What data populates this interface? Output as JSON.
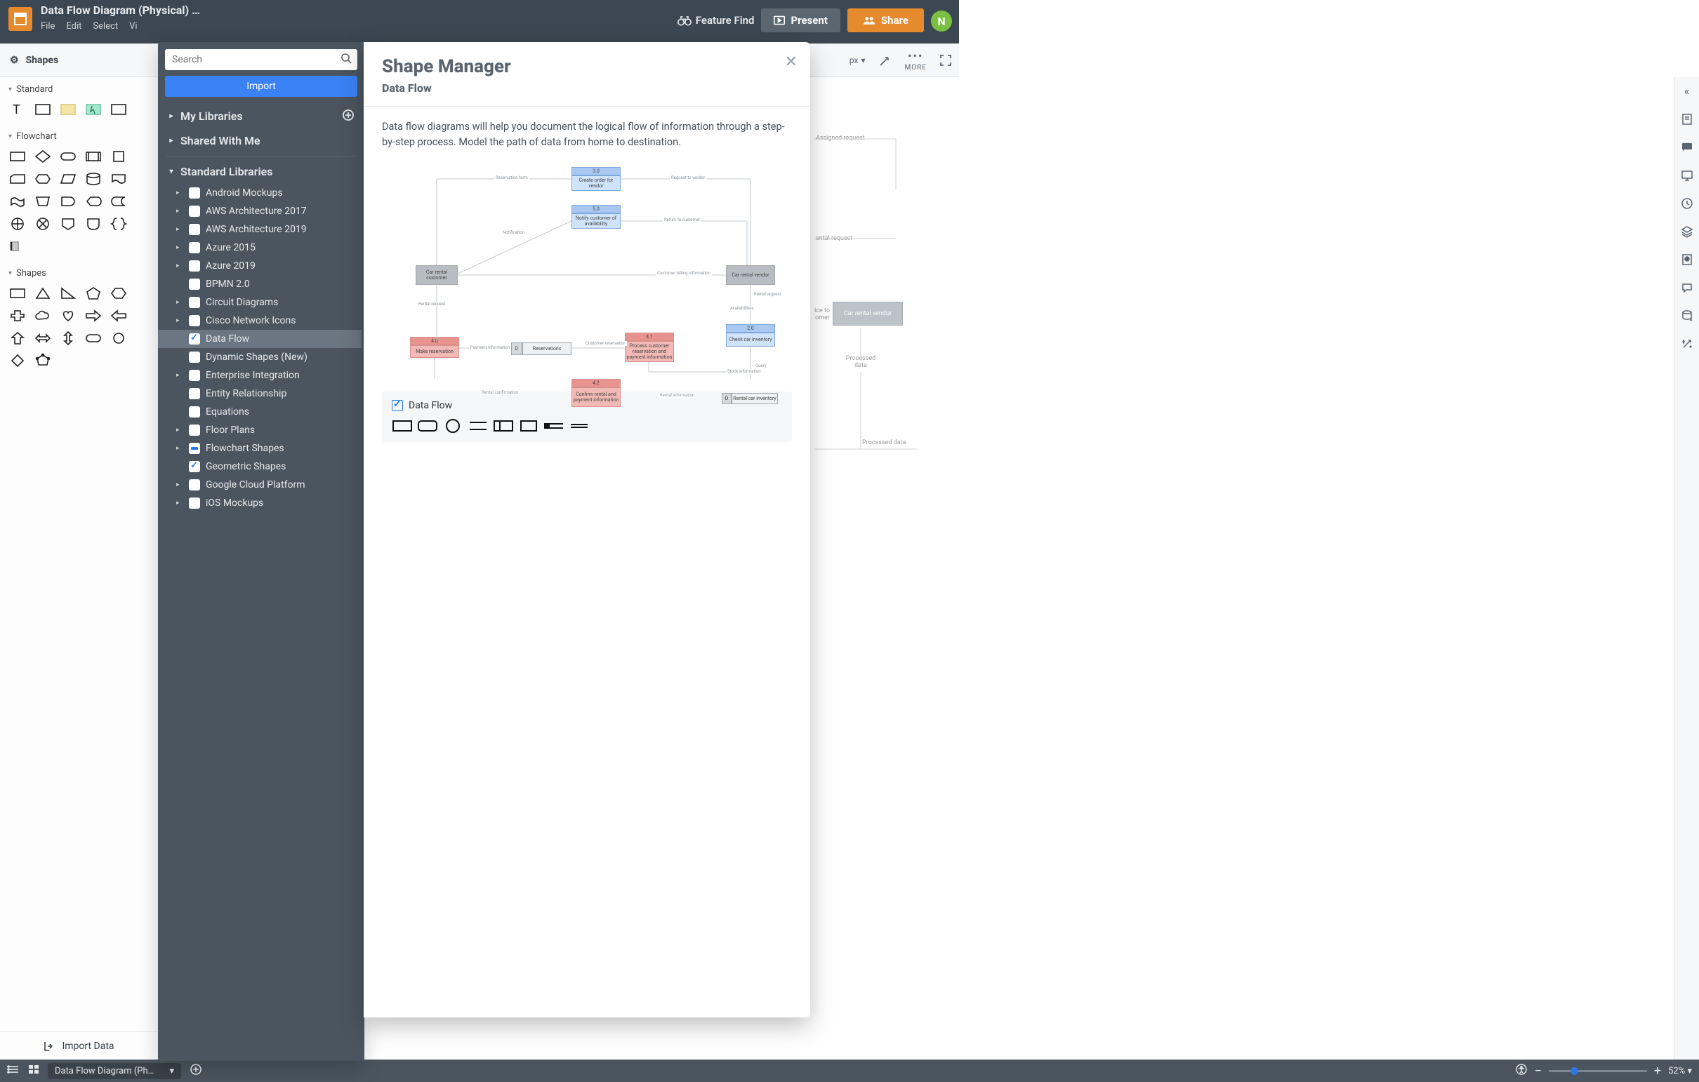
{
  "header": {
    "doc_title": "Data Flow Diagram (Physical) …",
    "menu": [
      "File",
      "Edit",
      "Select",
      "Vi"
    ],
    "feature_find": "Feature Find",
    "present": "Present",
    "share": "Share",
    "avatar_initial": "N"
  },
  "toolbar": {
    "zoom_unit_hint": "px",
    "more": "MORE"
  },
  "shapes_panel": {
    "title": "Shapes",
    "groups": {
      "standard": {
        "title": "Standard"
      },
      "flowchart": {
        "title": "Flowchart"
      },
      "shapes": {
        "title": "Shapes"
      }
    },
    "import_data": "Import Data"
  },
  "library_panel": {
    "search_placeholder": "Search",
    "import": "Import",
    "sections": {
      "my_libraries": "My Libraries",
      "shared": "Shared With Me",
      "standard": "Standard Libraries"
    },
    "items": [
      {
        "label": "Android Mockups",
        "expandable": true,
        "checked": false
      },
      {
        "label": "AWS Architecture 2017",
        "expandable": true,
        "checked": false
      },
      {
        "label": "AWS Architecture 2019",
        "expandable": true,
        "checked": false
      },
      {
        "label": "Azure 2015",
        "expandable": true,
        "checked": false
      },
      {
        "label": "Azure 2019",
        "expandable": true,
        "checked": false
      },
      {
        "label": "BPMN 2.0",
        "expandable": false,
        "checked": false
      },
      {
        "label": "Circuit Diagrams",
        "expandable": true,
        "checked": false
      },
      {
        "label": "Cisco Network Icons",
        "expandable": true,
        "checked": false
      },
      {
        "label": "Data Flow",
        "expandable": false,
        "checked": true,
        "selected": true
      },
      {
        "label": "Dynamic Shapes (New)",
        "expandable": false,
        "checked": false
      },
      {
        "label": "Enterprise Integration",
        "expandable": true,
        "checked": false
      },
      {
        "label": "Entity Relationship",
        "expandable": false,
        "checked": false
      },
      {
        "label": "Equations",
        "expandable": false,
        "checked": false
      },
      {
        "label": "Floor Plans",
        "expandable": true,
        "checked": false
      },
      {
        "label": "Flowchart Shapes",
        "expandable": true,
        "checked": "partial"
      },
      {
        "label": "Geometric Shapes",
        "expandable": false,
        "checked": true
      },
      {
        "label": "Google Cloud Platform",
        "expandable": true,
        "checked": false
      },
      {
        "label": "iOS Mockups",
        "expandable": true,
        "checked": false
      }
    ]
  },
  "shape_manager": {
    "title": "Shape Manager",
    "subtitle": "Data Flow",
    "description": "Data flow diagrams will help you document the logical flow of information through a step-by-step process. Model the path of data from home to destination.",
    "checkbox_label": "Data Flow"
  },
  "preview": {
    "nodes": {
      "n1": {
        "num": "3.0",
        "text": "Create order for vendor"
      },
      "n2": {
        "num": "5.0",
        "text": "Notify customer of availability"
      },
      "n3": {
        "text": "Car rental customer"
      },
      "n4": {
        "text": "Car rental vendor"
      },
      "n5": {
        "num": "4.0",
        "text": "Make reservation"
      },
      "n6": {
        "id": "D",
        "text": "Reservations"
      },
      "n7": {
        "num": "4.1",
        "text": "Process customer reservation and payment information"
      },
      "n8": {
        "num": "2.0",
        "text": "Check car inventory"
      },
      "n9": {
        "num": "4.2",
        "text": "Confirm rental and payment information"
      },
      "n10": {
        "id": "D",
        "text": "Rental car inventory"
      }
    },
    "edges": {
      "e1": "Reservation form",
      "e2": "Request to vendor",
      "e3": "Notification",
      "e4": "Return to customer",
      "e5": "Customer billing information",
      "e6": "Rental request",
      "e7": "Payment information",
      "e8": "Customer reservation",
      "e9": "Availabilities",
      "e10": "Rental request",
      "e11": "Query",
      "e12": "Stock information",
      "e13": "Rental confirmation",
      "e14": "Rental information"
    }
  },
  "canvas_visible": {
    "labels": {
      "assigned_request": "Assigned request",
      "rental_request": "ental request",
      "vendor": "Car rental vendor",
      "service_to_customer": "ice to omer",
      "processed_data_1": "Processed data",
      "processed_data_2": "Processed data"
    }
  },
  "statusbar": {
    "doc_tab": "Data Flow Diagram (Ph…",
    "zoom_label": "52%",
    "zoom_value": 52
  }
}
